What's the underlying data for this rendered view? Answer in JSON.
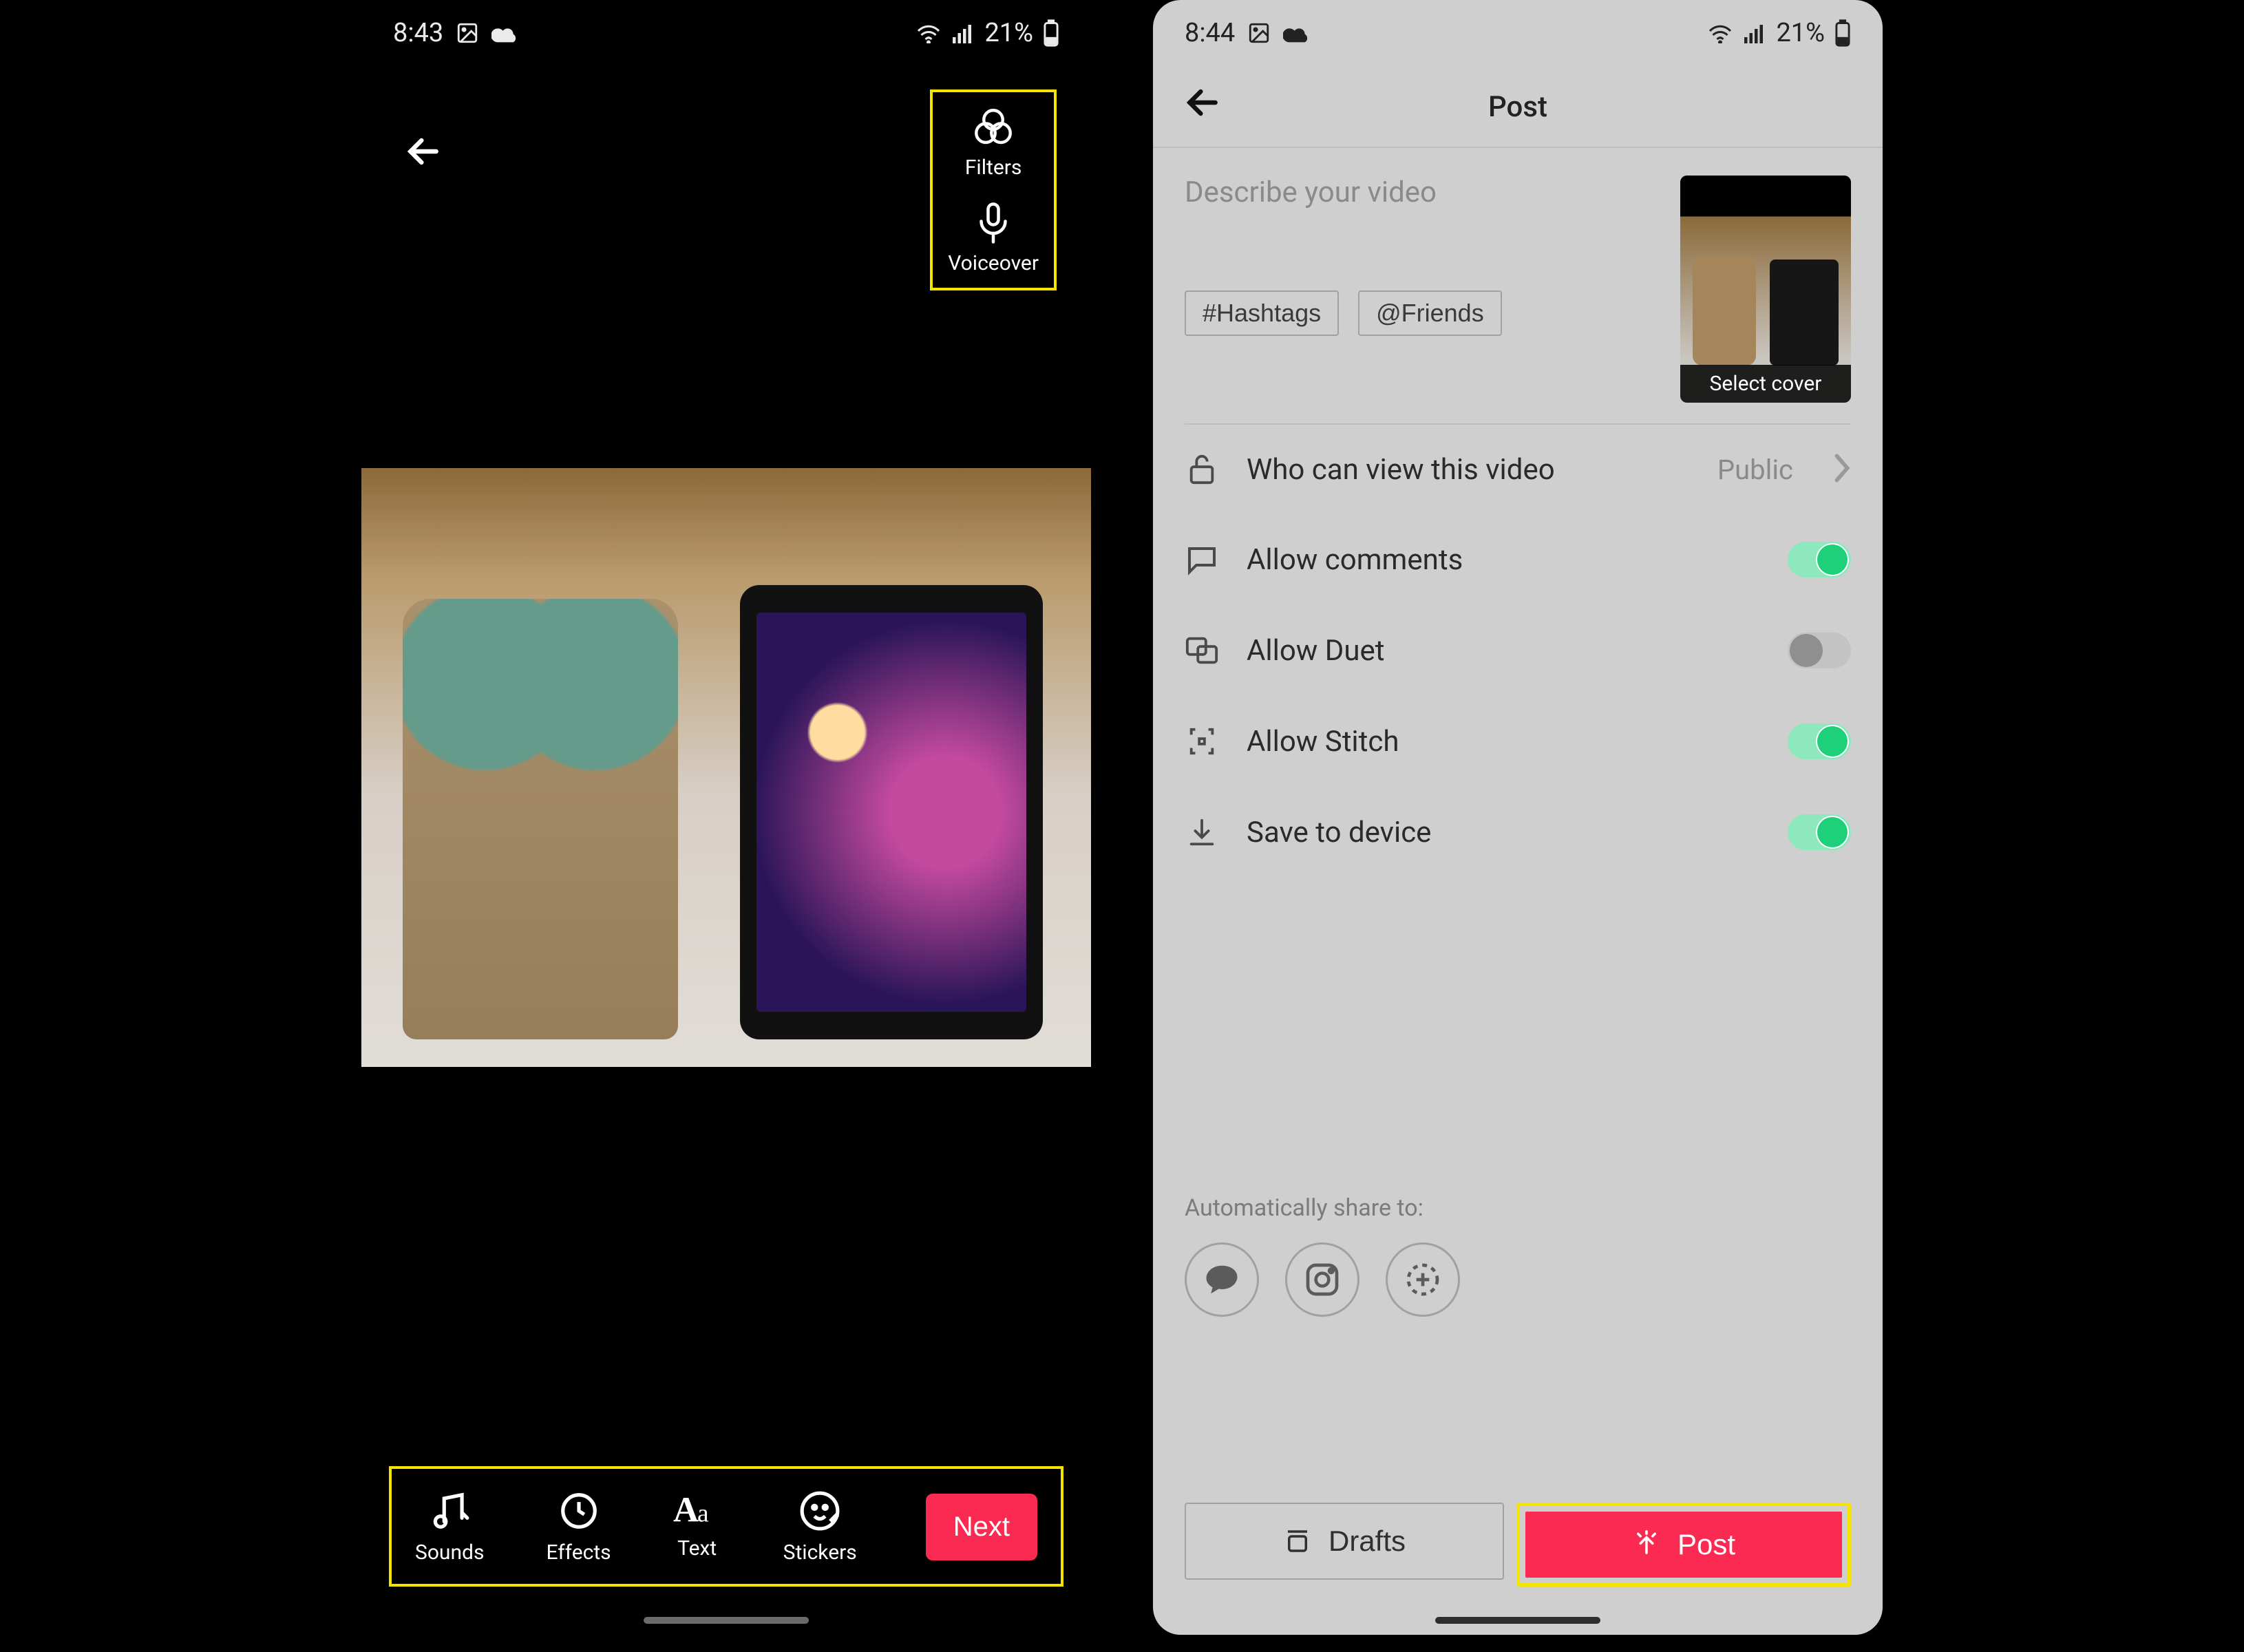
{
  "left": {
    "status": {
      "time": "8:43",
      "battery": "21%"
    },
    "side_tools": {
      "filters": "Filters",
      "voiceover": "Voiceover"
    },
    "bottom_tools": {
      "sounds": "Sounds",
      "effects": "Effects",
      "text": "Text",
      "stickers": "Stickers"
    },
    "next": "Next"
  },
  "right": {
    "status": {
      "time": "8:44",
      "battery": "21%"
    },
    "header": {
      "title": "Post"
    },
    "describe_placeholder": "Describe your video",
    "chips": {
      "hashtags": "#Hashtags",
      "friends": "@Friends"
    },
    "cover_label": "Select cover",
    "settings": {
      "privacy": {
        "label": "Who can view this video",
        "value": "Public"
      },
      "comments": {
        "label": "Allow comments",
        "on": true
      },
      "duet": {
        "label": "Allow Duet",
        "on": false
      },
      "stitch": {
        "label": "Allow Stitch",
        "on": true
      },
      "save": {
        "label": "Save to device",
        "on": true
      }
    },
    "share_label": "Automatically share to:",
    "drafts": "Drafts",
    "post": "Post"
  }
}
